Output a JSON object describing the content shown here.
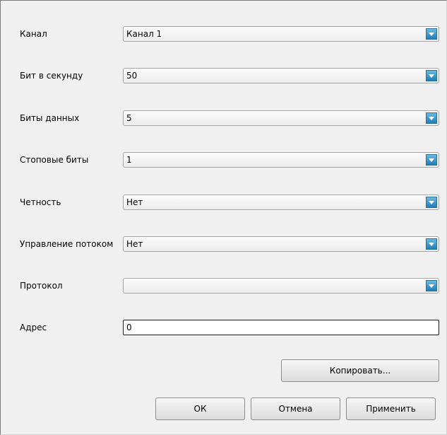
{
  "fields": [
    {
      "label": "Канал",
      "value": "Канал 1"
    },
    {
      "label": "Бит в секунду",
      "value": "50"
    },
    {
      "label": "Биты данных",
      "value": "5"
    },
    {
      "label": "Стоповые биты",
      "value": "1"
    },
    {
      "label": "Четность",
      "value": "Нет"
    },
    {
      "label": "Управление потоком",
      "value": "Нет"
    },
    {
      "label": "Протокол",
      "value": ""
    }
  ],
  "address": {
    "label": "Адрес",
    "value": "0"
  },
  "buttons": {
    "copy": "Копировать...",
    "ok": "ОК",
    "cancel": "Отмена",
    "apply": "Применить"
  },
  "icons": {
    "dropdown": "chevron-down-icon"
  },
  "colors": {
    "dropdown_arrow": "#1f7eb5",
    "background": "#f0f0f0"
  }
}
